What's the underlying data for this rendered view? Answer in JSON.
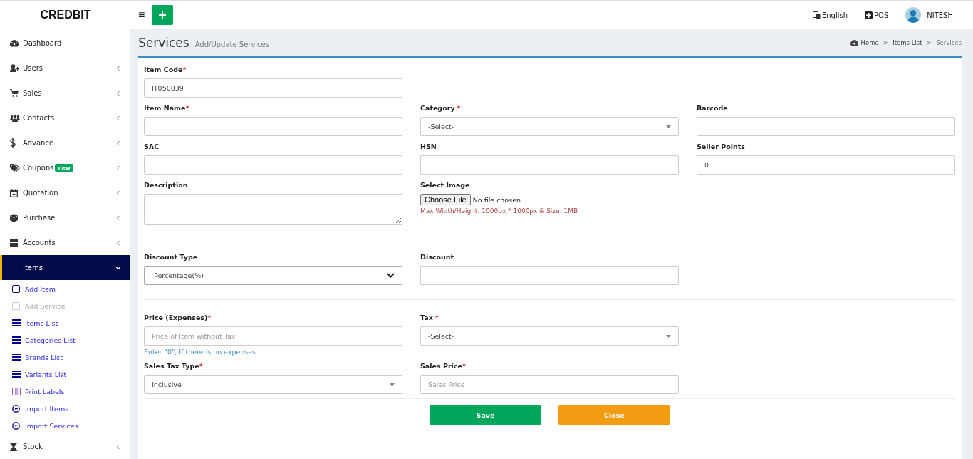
{
  "brand": "CREDBIT",
  "topbar": {
    "menu_icon": "≡",
    "language": "English",
    "pos": "POS",
    "user": "NITESH"
  },
  "sidebar": {
    "items": [
      {
        "label": "Dashboard",
        "selected": false
      },
      {
        "label": "Users",
        "selected": false,
        "expanded": false
      },
      {
        "label": "Sales",
        "selected": false,
        "expanded": false
      },
      {
        "label": "Contacts",
        "selected": false,
        "expanded": false
      },
      {
        "label": "Advance",
        "selected": false,
        "expanded": false
      },
      {
        "label": "Coupons",
        "badge": "new",
        "selected": false,
        "expanded": false
      },
      {
        "label": "Quotation",
        "selected": false,
        "expanded": false
      },
      {
        "label": "Purchase",
        "selected": false,
        "expanded": false
      },
      {
        "label": "Accounts",
        "selected": false,
        "expanded": false
      },
      {
        "label": "Items",
        "selected": true,
        "expanded": true,
        "children": [
          {
            "label": "Add Item",
            "selected": false
          },
          {
            "label": "Add Service",
            "selected": true
          },
          {
            "label": "Items List",
            "selected": false
          },
          {
            "label": "Categories List",
            "selected": false
          },
          {
            "label": "Brands List",
            "selected": false
          },
          {
            "label": "Variants List",
            "selected": false
          },
          {
            "label": "Print Labels",
            "selected": false
          },
          {
            "label": "Import Items",
            "selected": false
          },
          {
            "label": "Import Services",
            "selected": false
          }
        ]
      },
      {
        "label": "Stock",
        "selected": false,
        "expanded": false
      }
    ]
  },
  "page": {
    "title": "Services",
    "subtitle": "Add/Update Services",
    "breadcrumb": [
      "Home",
      "Items List",
      "Services"
    ],
    "separator": ">"
  },
  "sections": [
    {
      "rows": [
        [
          {
            "kind": "text",
            "label": "Item Code",
            "required": "*",
            "value": "IT050039"
          }
        ],
        [
          {
            "kind": "text",
            "label": "Item Name",
            "required": "*"
          },
          {
            "kind": "select",
            "label": "Category",
            "required": "*",
            "value": "-Select-"
          },
          {
            "kind": "text",
            "label": "Barcode"
          }
        ],
        [
          {
            "kind": "text",
            "label": "SAC"
          },
          {
            "kind": "text",
            "label": "HSN"
          },
          {
            "kind": "text",
            "label": "Seller Points",
            "value": "0"
          }
        ],
        [
          {
            "kind": "textarea",
            "label": "Description"
          },
          {
            "kind": "file",
            "label": "Select Image",
            "button": "Choose File",
            "status": "No file chosen",
            "hint": "Max Width/Height: 1000px * 1000px & Size: 1MB"
          }
        ]
      ]
    },
    {
      "rows": [
        [
          {
            "kind": "native-select",
            "label": "Discount Type",
            "value": "Percentage(%)"
          },
          {
            "kind": "text",
            "label": "Discount"
          }
        ]
      ]
    },
    {
      "rows": [
        [
          {
            "kind": "text",
            "label": "Price (Expenses)",
            "required": "*",
            "placeholder": "Price of Item without Tax",
            "help": "Enter \"0\", If there is no expenses"
          },
          {
            "kind": "select",
            "label": "Tax",
            "required": "*",
            "value": "-Select-"
          }
        ],
        [
          {
            "kind": "select",
            "label": "Sales Tax Type",
            "required": "*",
            "value": "Inclusive"
          },
          {
            "kind": "text",
            "label": "Sales Price",
            "required": "*",
            "placeholder": "Sales Price"
          }
        ]
      ]
    }
  ],
  "buttons": [
    {
      "label": "Save",
      "kind": "primary"
    },
    {
      "label": "Close",
      "kind": "warning"
    }
  ]
}
